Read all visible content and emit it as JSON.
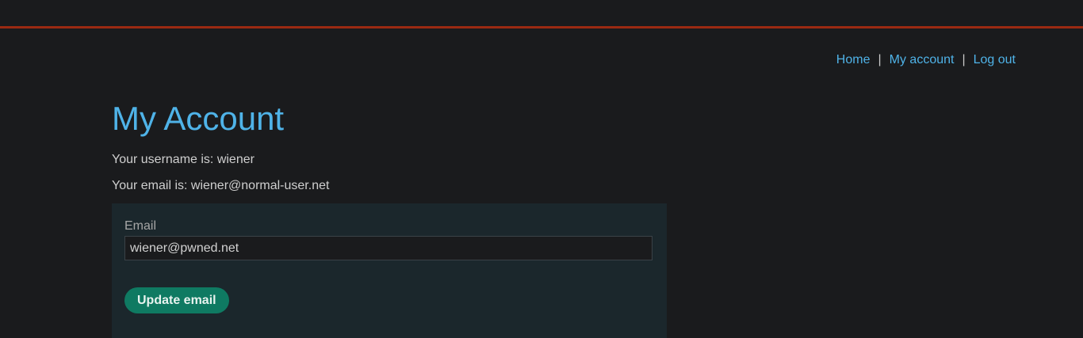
{
  "nav": {
    "home": "Home",
    "separator": "|",
    "my_account": "My account",
    "logout": "Log out"
  },
  "page": {
    "title": "My Account",
    "username_text": "Your username is: wiener",
    "email_text": "Your email is: wiener@normal-user.net"
  },
  "form": {
    "email_label": "Email",
    "email_value": "wiener@pwned.net",
    "submit_label": "Update email"
  },
  "colors": {
    "background": "#1a1b1d",
    "accent_link": "#4fb3e8",
    "top_rule": "#9b2a12",
    "panel": "#1b272c",
    "button": "#0f7a62"
  }
}
